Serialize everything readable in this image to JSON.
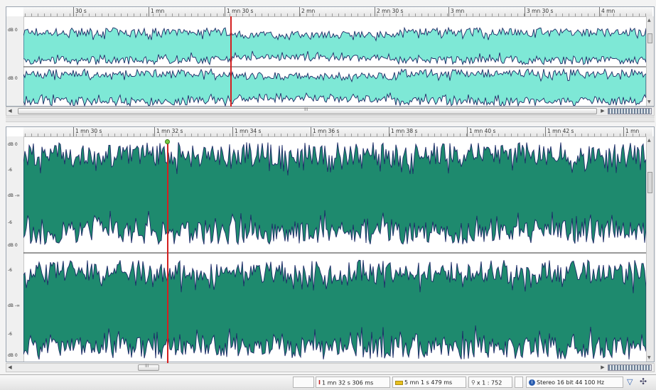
{
  "overview": {
    "ruler_labels": [
      "30 s",
      "1 mn",
      "1 mn 30 s",
      "2 mn",
      "2 mn 30 s",
      "3 mn",
      "3 mn 30 s",
      "4 mn"
    ],
    "db_labels": [
      "dB 0",
      "dB 0"
    ],
    "scroll_center": "III",
    "waveform_color": "#7ee8d6"
  },
  "detail": {
    "ruler_labels": [
      "1 mn 30 s",
      "1 mn 32 s",
      "1 mn 34 s",
      "1 mn 36 s",
      "1 mn 38 s",
      "1 mn 40 s",
      "1 mn 42 s",
      "1 mn"
    ],
    "db_labels_top": [
      "dB 0",
      "-6",
      "dB -∞",
      "-6",
      "dB 0"
    ],
    "db_labels_bottom": [
      "-6",
      "dB -∞",
      "-6",
      "dB 0"
    ],
    "scroll_center": "III",
    "waveform_color": "#1e8a6e"
  },
  "cursor_color": "#d42020",
  "status": {
    "cursor_position": "1 mn 32 s 306 ms",
    "duration": "5 mn 1 s 479 ms",
    "zoom": "x 1 : 752",
    "format": "Stereo 16 bit 44 100 Hz"
  }
}
